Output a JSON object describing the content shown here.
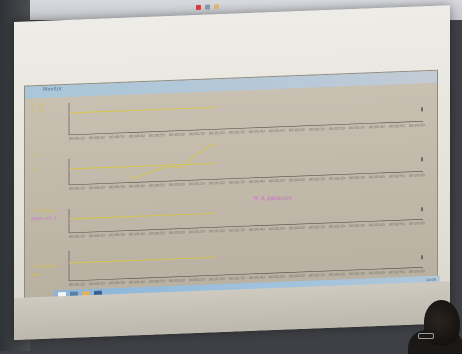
{
  "app": {
    "title": "Monitor",
    "watermark": "Tr A pplause"
  },
  "left_labels": {
    "row1": [
      "G: 100",
      "B: 100"
    ],
    "row2": [
      "G: 1",
      "Pl: 1"
    ],
    "row3": [
      "Pl: Pressure",
      "AMRW Vol: 0"
    ],
    "row4": [
      "P: Ventilation",
      "Tidal"
    ]
  },
  "axis_ticks": [
    "00:00:10",
    "00:00:20",
    "00:00:30",
    "00:00:40",
    "00:00:50",
    "00:01:00",
    "00:01:10",
    "00:01:20",
    "00:01:30",
    "00:01:40",
    "00:01:50",
    "00:02:00",
    "00:02:10",
    "00:02:20",
    "00:02:30",
    "00:02:40",
    "00:02:50",
    "00:03:00"
  ],
  "taskbar": {
    "clock": "14:05"
  },
  "colors": {
    "trace": "#d7c64a",
    "watermark": "#d36ad0",
    "taskbar": "#9ec1dd",
    "title_bar": "#b9c9d8"
  }
}
